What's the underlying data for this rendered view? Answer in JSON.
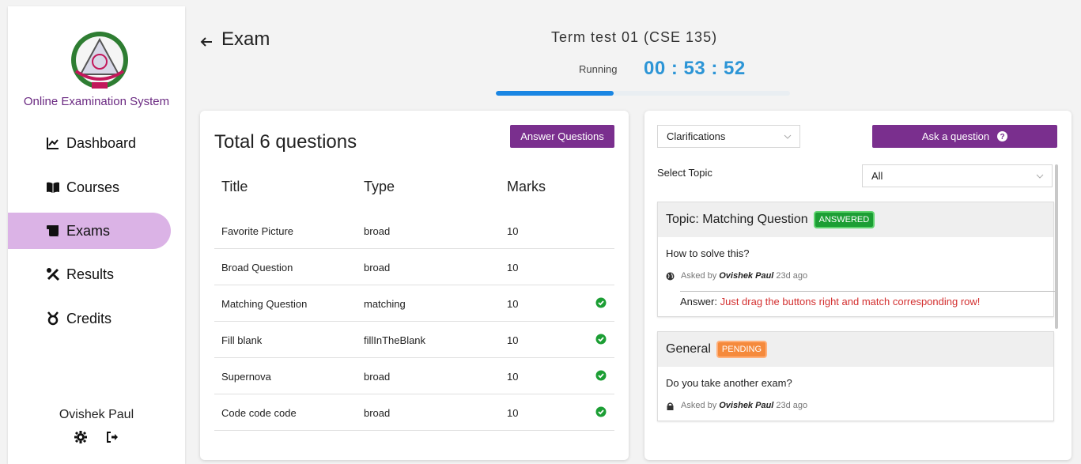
{
  "sidebar": {
    "brand": "Online Examination System",
    "items": [
      {
        "label": "Dashboard",
        "icon": "chart-line-icon"
      },
      {
        "label": "Courses",
        "icon": "book-open-icon"
      },
      {
        "label": "Exams",
        "icon": "scroll-icon",
        "active": true
      },
      {
        "label": "Results",
        "icon": "tools-icon"
      },
      {
        "label": "Credits",
        "icon": "ribbon-icon"
      }
    ],
    "user_name": "Ovishek Paul"
  },
  "header": {
    "page_title": "Exam",
    "exam_title": "Term test 01 (CSE 135)",
    "status": "Running",
    "timer": "00 : 53 : 52",
    "progress_fraction": 0.4
  },
  "questions": {
    "total_label": "Total 6 questions",
    "answer_button": "Answer Questions",
    "columns": [
      "Title",
      "Type",
      "Marks"
    ],
    "rows": [
      {
        "title": "Favorite Picture",
        "type": "broad",
        "marks": "10",
        "answered": false
      },
      {
        "title": "Broad Question",
        "type": "broad",
        "marks": "10",
        "answered": false
      },
      {
        "title": "Matching Question",
        "type": "matching",
        "marks": "10",
        "answered": true
      },
      {
        "title": "Fill blank",
        "type": "fillInTheBlank",
        "marks": "10",
        "answered": true
      },
      {
        "title": "Supernova",
        "type": "broad",
        "marks": "10",
        "answered": true
      },
      {
        "title": "Code code code",
        "type": "broad",
        "marks": "10",
        "answered": true
      }
    ]
  },
  "clarifications": {
    "select_value": "Clarifications",
    "ask_button": "Ask a question",
    "select_topic_label": "Select Topic",
    "topic_value": "All",
    "cards": [
      {
        "title": "Topic: Matching Question",
        "badge": "ANSWERED",
        "question": "How to solve this?",
        "asked_prefix": "Asked by",
        "asker": "Ovishek Paul",
        "time": "23d ago",
        "answer_label": "Answer:",
        "answer_text": "Just drag the buttons right and match corresponding row!"
      },
      {
        "title": "General",
        "badge": "PENDING",
        "question": "Do you take another exam?",
        "asked_prefix": "Asked by",
        "asker": "Ovishek Paul",
        "time": "23d ago"
      }
    ]
  },
  "colors": {
    "accent_purple": "#7a2f8e",
    "active_nav": "#dbb3e6",
    "timer_blue": "#2c95d6",
    "progress_blue": "#1a86e3",
    "answered_green": "#1c9e34",
    "pending_orange": "#f58a3c",
    "answer_red": "#d32f2f"
  }
}
